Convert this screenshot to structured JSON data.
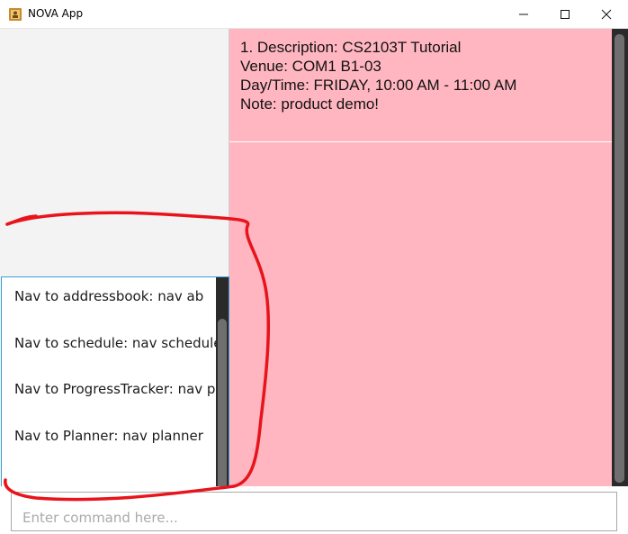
{
  "window": {
    "title": "NOVA App",
    "icon": "app-icon"
  },
  "nav_list": {
    "items": [
      "Nav to addressbook: nav ab",
      "Nav to schedule: nav schedule",
      "Nav to ProgressTracker: nav pr",
      "Nav to Planner: nav planner"
    ]
  },
  "schedule_card": {
    "line1": "1. Description: CS2103T Tutorial",
    "line2": "Venue: COM1 B1-03",
    "line3": "Day/Time: FRIDAY, 10:00 AM - 11:00 AM",
    "line4": "Note: product demo!"
  },
  "command_box": {
    "value": "",
    "placeholder": "Enter command here..."
  },
  "colors": {
    "accent_pink": "#ffb6c1",
    "annotation_red": "#e8131b",
    "list_border": "#3a9fd6"
  }
}
